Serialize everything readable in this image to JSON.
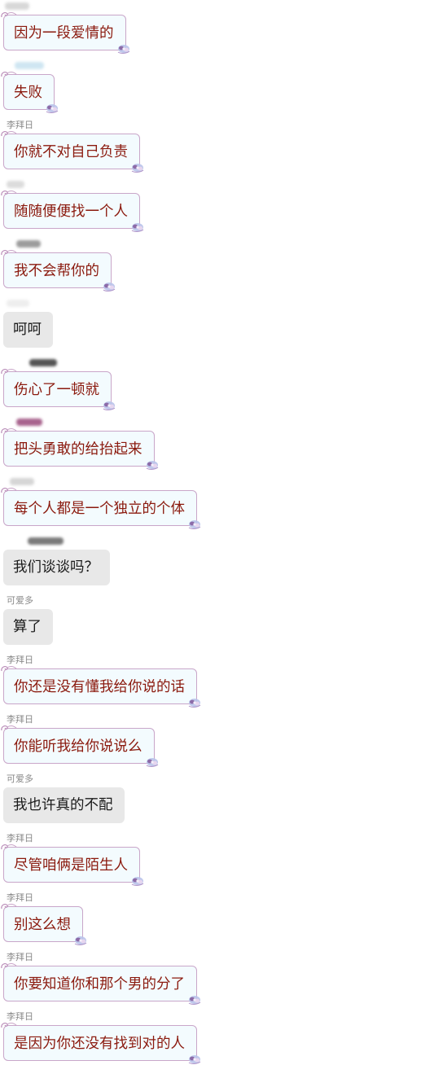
{
  "chat": {
    "messages": [
      {
        "sender": "",
        "text": "因为一段爱情的",
        "style": "theme",
        "avatar_color": "#d8d8d8"
      },
      {
        "sender": "",
        "text": "失败",
        "style": "theme",
        "avatar_color": "#cfe6f2"
      },
      {
        "sender": "李拜日",
        "text": "你就不对自己负责",
        "style": "theme",
        "avatar_color": ""
      },
      {
        "sender": "",
        "text": "随随便便找一个人",
        "style": "theme",
        "avatar_color": "#dcdcdc"
      },
      {
        "sender": "",
        "text": "我不会帮你的",
        "style": "theme",
        "avatar_color": "#9c9c9c"
      },
      {
        "sender": "",
        "text": "呵呵",
        "style": "plain",
        "avatar_color": "#eeeeee"
      },
      {
        "sender": "",
        "text": "伤心了一顿就",
        "style": "theme",
        "avatar_color": "#555555"
      },
      {
        "sender": "",
        "text": "把头勇敢的给抬起来",
        "style": "theme",
        "avatar_color": "#a8638d"
      },
      {
        "sender": "",
        "text": "每个人都是一个独立的个体",
        "style": "theme",
        "avatar_color": "#d6d6d6"
      },
      {
        "sender": "",
        "text": "我们谈谈吗？",
        "style": "plain",
        "avatar_color": "#7a7a7a"
      },
      {
        "sender": "可爱多",
        "text": "算了",
        "style": "plain",
        "avatar_color": ""
      },
      {
        "sender": "李拜日",
        "text": "你还是没有懂我给你说的话",
        "style": "theme",
        "avatar_color": ""
      },
      {
        "sender": "李拜日",
        "text": "你能听我给你说说么",
        "style": "theme",
        "avatar_color": ""
      },
      {
        "sender": "可爱多",
        "text": "我也许真的不配",
        "style": "plain",
        "avatar_color": ""
      },
      {
        "sender": "李拜日",
        "text": "尽管咱俩是陌生人",
        "style": "theme",
        "avatar_color": ""
      },
      {
        "sender": "李拜日",
        "text": "别这么想",
        "style": "theme",
        "avatar_color": ""
      },
      {
        "sender": "李拜日",
        "text": "你要知道你和那个男的分了",
        "style": "theme",
        "avatar_color": ""
      },
      {
        "sender": "李拜日",
        "text": "是因为你还没有找到对的人",
        "style": "theme",
        "avatar_color": ""
      }
    ]
  }
}
